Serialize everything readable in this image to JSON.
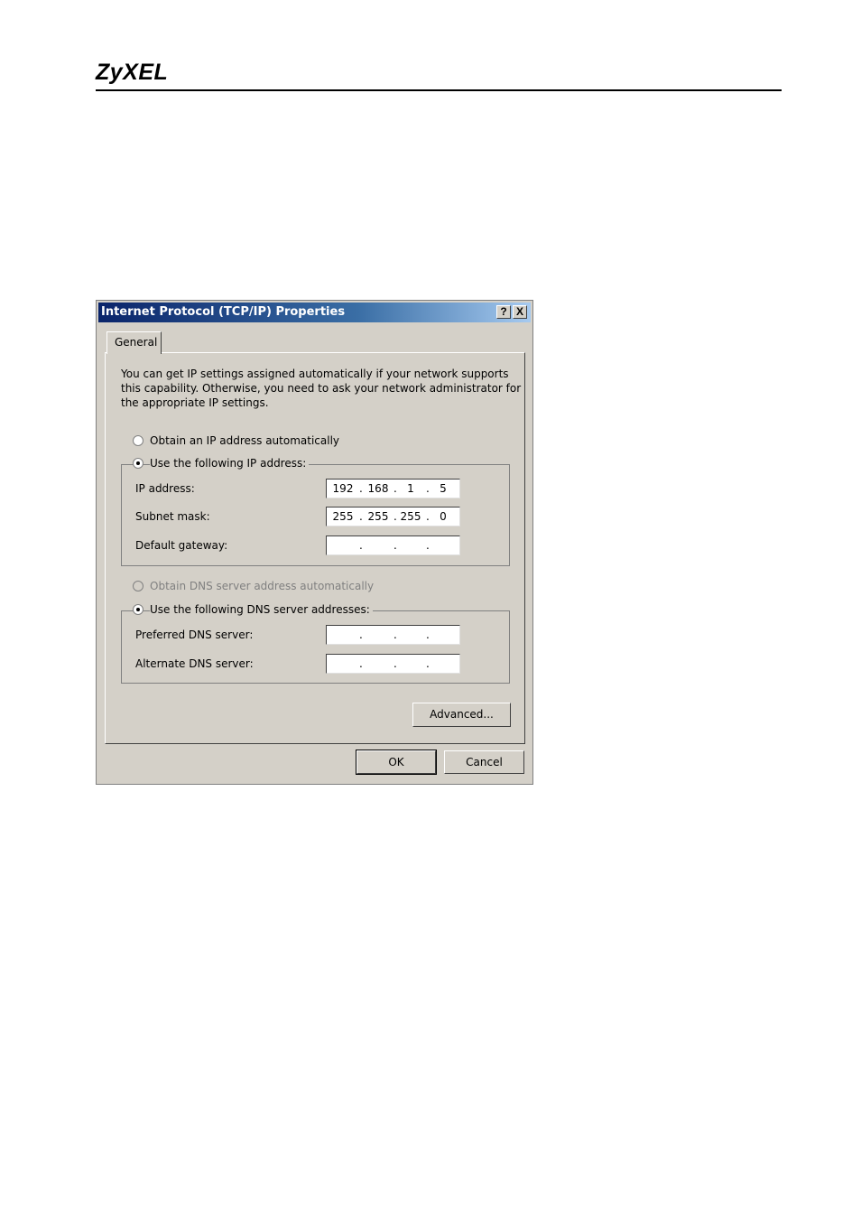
{
  "page": {
    "brand": "ZyXEL"
  },
  "dialog": {
    "title": "Internet Protocol (TCP/IP) Properties",
    "help_glyph": "?",
    "close_glyph": "X",
    "tabs": [
      {
        "label": "General"
      }
    ],
    "intro_lines": [
      "You can get IP settings assigned automatically if your network supports",
      "this capability. Otherwise, you need to ask your network administrator for",
      "the appropriate IP settings."
    ],
    "ip_options": {
      "auto_label": "Obtain an IP address automatically",
      "manual_label": "Use the following IP address:",
      "selected": "manual"
    },
    "ip_fields": [
      {
        "label": "IP address:",
        "octets": [
          "192",
          "168",
          "1",
          "5"
        ]
      },
      {
        "label": "Subnet mask:",
        "octets": [
          "255",
          "255",
          "255",
          "0"
        ]
      },
      {
        "label": "Default gateway:",
        "octets": [
          "",
          "",
          "",
          ""
        ]
      }
    ],
    "dns_options": {
      "auto_label": "Obtain DNS server address automatically",
      "manual_label": "Use the following DNS server addresses:",
      "selected": "manual",
      "auto_disabled": true
    },
    "dns_fields": [
      {
        "label": "Preferred DNS server:",
        "octets": [
          "",
          "",
          "",
          ""
        ]
      },
      {
        "label": "Alternate DNS server:",
        "octets": [
          "",
          "",
          "",
          ""
        ]
      }
    ],
    "dot_separator": ".",
    "buttons": {
      "advanced": "Advanced...",
      "ok": "OK",
      "cancel": "Cancel"
    }
  }
}
